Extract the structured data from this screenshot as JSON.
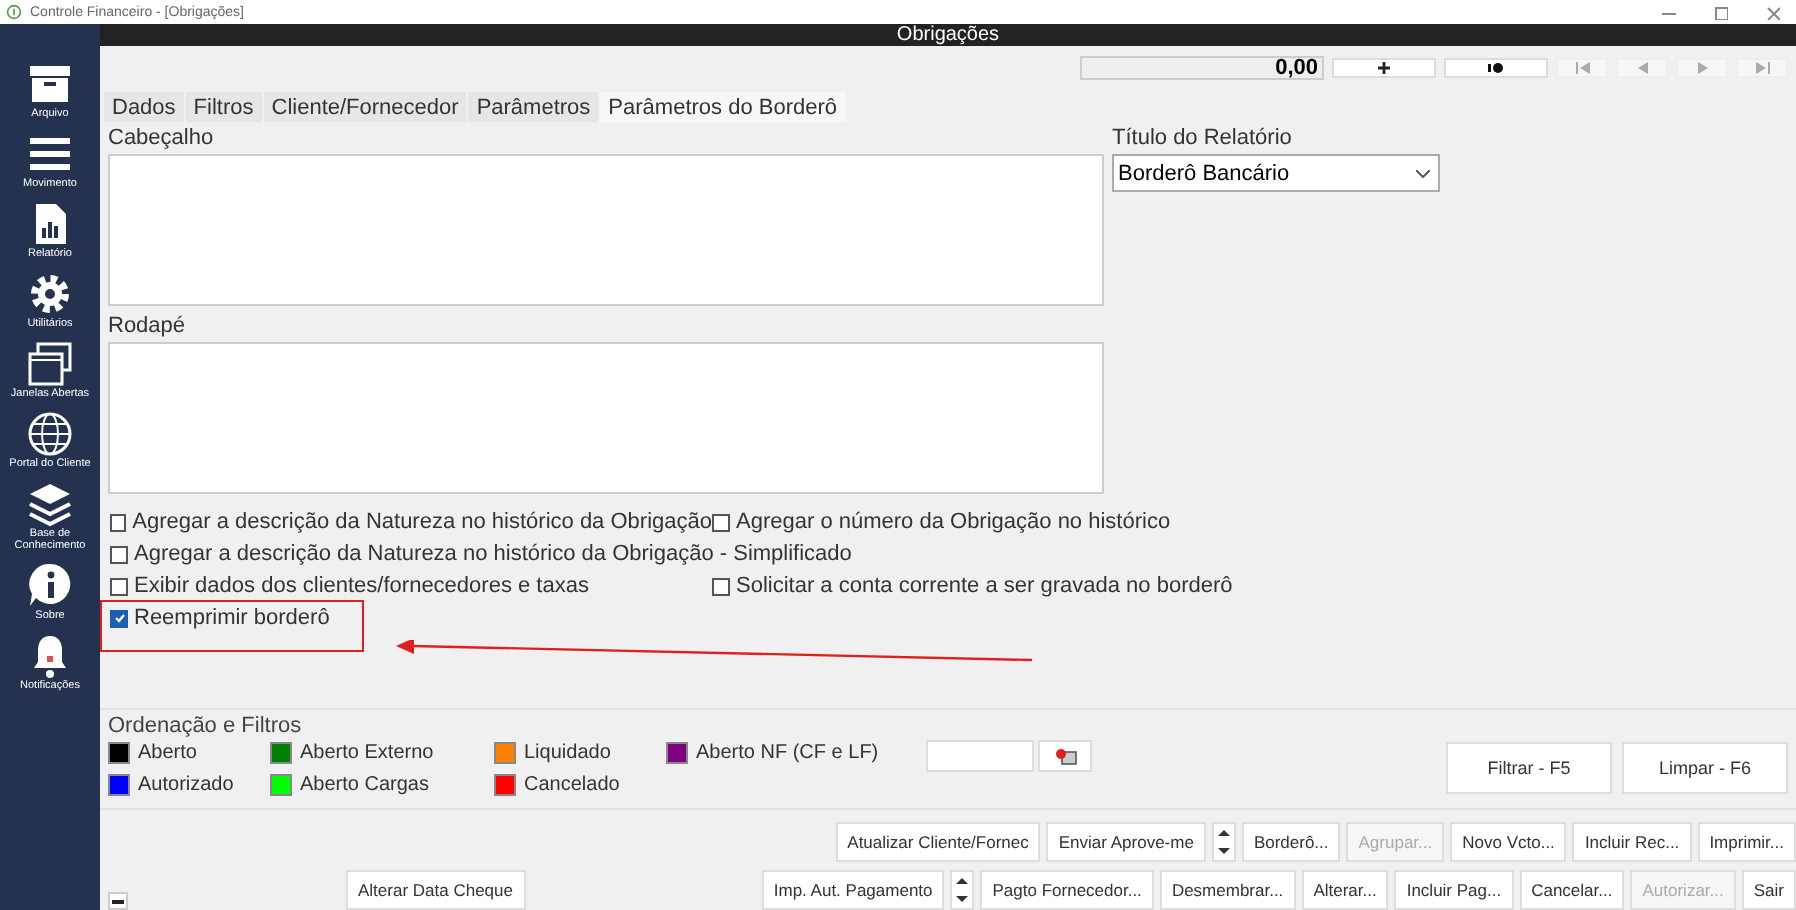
{
  "window": {
    "title": "Controle Financeiro - [Obrigações]"
  },
  "sidebar": {
    "items": [
      {
        "label": "Arquivo",
        "kind": "box"
      },
      {
        "label": "Movimento",
        "kind": "menu"
      },
      {
        "label": "Relatório",
        "kind": "report"
      },
      {
        "label": "Utilitários",
        "kind": "gear"
      },
      {
        "label": "Janelas Abertas",
        "kind": "windows"
      },
      {
        "label": "Portal do Cliente",
        "kind": "globe"
      },
      {
        "label": "Base de Conhecimento",
        "kind": "layers"
      },
      {
        "label": "Sobre",
        "kind": "info"
      },
      {
        "label": "Notificações",
        "kind": "bell"
      }
    ]
  },
  "header": {
    "title": "Obrigações"
  },
  "toolbar": {
    "total": "0,00"
  },
  "tabs": [
    {
      "label": "Dados",
      "selected": false
    },
    {
      "label": "Filtros",
      "selected": false
    },
    {
      "label": "Cliente/Fornecedor",
      "selected": false
    },
    {
      "label": "Parâmetros",
      "selected": false
    },
    {
      "label": "Parâmetros do Borderô",
      "selected": true
    }
  ],
  "form": {
    "header_label": "Cabeçalho",
    "footer_label": "Rodapé",
    "report_title_label": "Título do Relatório",
    "report_title_value": "Borderô Bancário"
  },
  "checkboxes": [
    {
      "label": "Agregar a descrição da Natureza no histórico da Obrigação",
      "checked": false
    },
    {
      "label": "Agregar o número da Obrigação no histórico",
      "checked": false
    },
    {
      "label": "Agregar a descrição da Natureza no histórico da Obrigação - Simplificado",
      "checked": false
    },
    {
      "label": "Exibir dados dos clientes/fornecedores e taxas",
      "checked": false
    },
    {
      "label": "Solicitar a conta corrente a ser gravada no borderô",
      "checked": false
    },
    {
      "label": "Reemprimir borderô",
      "checked": true
    }
  ],
  "filters": {
    "title": "Ordenação e Filtros",
    "legend": [
      {
        "label": "Aberto",
        "color": "#000000"
      },
      {
        "label": "Aberto Externo",
        "color": "#008000"
      },
      {
        "label": "Liquidado",
        "color": "#ff8000"
      },
      {
        "label": "Aberto NF (CF e LF)",
        "color": "#800080"
      },
      {
        "label": "Autorizado",
        "color": "#0000ff"
      },
      {
        "label": "Aberto Cargas",
        "color": "#00ff00"
      },
      {
        "label": "Cancelado",
        "color": "#ff0000"
      }
    ],
    "filter_button": "Filtrar - F5",
    "clear_button": "Limpar - F6"
  },
  "actions_row_1": [
    {
      "label": "Atualizar Cliente/Fornec",
      "disabled": false
    },
    {
      "label": "Enviar Aprove-me",
      "disabled": false
    },
    {
      "kind": "spin"
    },
    {
      "label": "Borderô...",
      "disabled": false
    },
    {
      "label": "Agrupar...",
      "disabled": true
    },
    {
      "label": "Novo Vcto...",
      "disabled": false
    },
    {
      "label": "Incluir Rec...",
      "disabled": false
    },
    {
      "label": "Imprimir...",
      "disabled": false
    }
  ],
  "actions_row_2": [
    {
      "label": "Imp. Aut. Pagamento",
      "disabled": false
    },
    {
      "kind": "spin"
    },
    {
      "label": "Pagto Fornecedor...",
      "disabled": false
    },
    {
      "label": "Desmembrar...",
      "disabled": false
    },
    {
      "label": "Alterar...",
      "disabled": false
    },
    {
      "label": "Incluir Pag...",
      "disabled": false
    },
    {
      "label": "Cancelar...",
      "disabled": false
    },
    {
      "label": "Autorizar...",
      "disabled": true
    },
    {
      "label": "Sair",
      "disabled": false
    }
  ],
  "cheque_button": "Alterar Data Cheque"
}
